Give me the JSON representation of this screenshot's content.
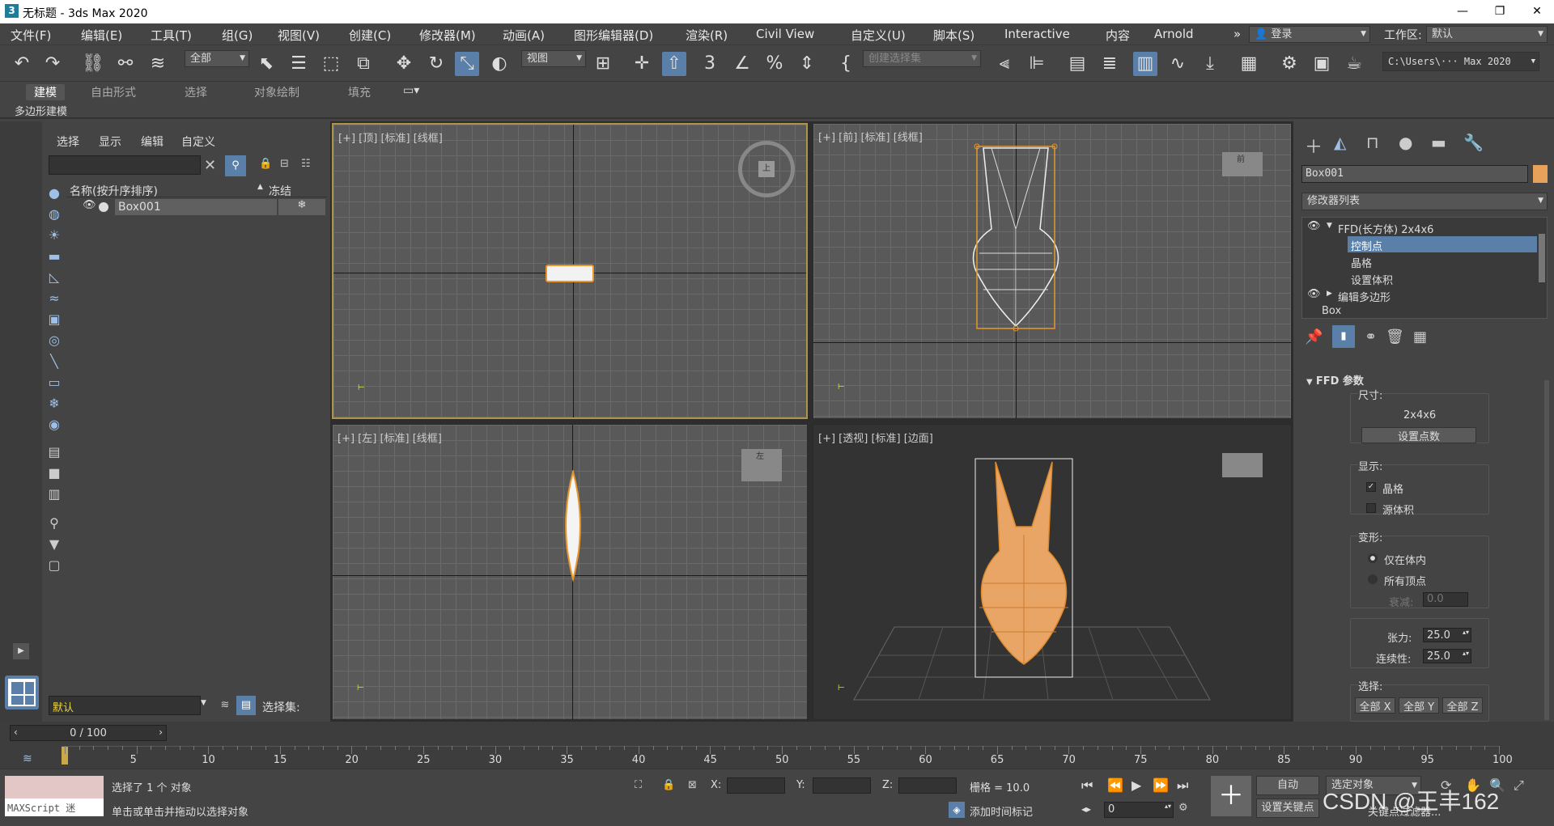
{
  "window": {
    "title": "无标题 - 3ds Max 2020",
    "app_icon": "3",
    "min": "—",
    "max": "❐",
    "close": "✕"
  },
  "menu": [
    "文件(F)",
    "编辑(E)",
    "工具(T)",
    "组(G)",
    "视图(V)",
    "创建(C)",
    "修改器(M)",
    "动画(A)",
    "图形编辑器(D)",
    "渲染(R)",
    "Civil View",
    "自定义(U)",
    "脚本(S)",
    "Interactive",
    "内容",
    "Arnold"
  ],
  "menu_more": "»",
  "login": "登录",
  "workspace_label": "工作区:",
  "workspace_value": "默认",
  "toolbar": {
    "filter": "全部",
    "ref_coord": "视图",
    "create_sel_set": "创建选择集",
    "path": "C:\\Users\\··· Max 2020",
    "spinner_label": "3"
  },
  "ribbon_tabs": [
    "建模",
    "自由形式",
    "选择",
    "对象绘制",
    "填充"
  ],
  "ribbon_sub": "多边形建模",
  "explorer": {
    "menu": [
      "选择",
      "显示",
      "编辑",
      "自定义"
    ],
    "col_name": "名称(按升序排序)",
    "col_freeze": "冻结",
    "row": "Box001",
    "layer": "默认",
    "selset": "选择集:"
  },
  "viewports": [
    {
      "id": "top",
      "label": "[+] [顶] [标准] [线框]"
    },
    {
      "id": "front",
      "label": "[+] [前] [标准] [线框]"
    },
    {
      "id": "left",
      "label": "[+] [左] [标准] [线框]"
    },
    {
      "id": "persp",
      "label": "[+] [透视] [标准] [边面]"
    }
  ],
  "viewcube": {
    "top": "上",
    "front": "前",
    "left": "左"
  },
  "cmd": {
    "object_name": "Box001",
    "modifier_list": "修改器列表",
    "stack": [
      {
        "label": "FFD(长方体) 2x4x6",
        "level": 0
      },
      {
        "label": "控制点",
        "level": 1,
        "selected": true
      },
      {
        "label": "晶格",
        "level": 1
      },
      {
        "label": "设置体积",
        "level": 1
      },
      {
        "label": "编辑多边形",
        "level": 0
      },
      {
        "label": "Box",
        "level": 0
      }
    ],
    "rollout_title": "FFD 参数",
    "dim_label": "尺寸:",
    "dim_value": "2x4x6",
    "set_points": "设置点数",
    "display_label": "显示:",
    "lattice": "晶格",
    "source_volume": "源体积",
    "deform_label": "变形:",
    "only_in_volume": "仅在体内",
    "all_vertices": "所有顶点",
    "falloff_label": "衰减:",
    "falloff_value": "0.0",
    "tension_label": "张力:",
    "tension_value": "25.0",
    "continuity_label": "连续性:",
    "continuity_value": "25.0",
    "select_label": "选择:",
    "sel_x": "全部 X",
    "sel_y": "全部 Y",
    "sel_z": "全部 Z"
  },
  "timeline": {
    "frame": "0 / 100",
    "ticks": [
      "5",
      "10",
      "15",
      "20",
      "25",
      "30",
      "35",
      "40",
      "45",
      "50",
      "55",
      "60",
      "65",
      "70",
      "75",
      "80",
      "85",
      "90",
      "95",
      "100"
    ]
  },
  "status": {
    "maxscript": "MAXScript 迷",
    "selected": "选择了 1 个 对象",
    "hint": "单击或单击并拖动以选择对象",
    "x": "X:",
    "y": "Y:",
    "z": "Z:",
    "grid": "栅格 = 10.0",
    "add_tag": "添加时间标记",
    "auto": "自动",
    "sel_obj": "选定对象",
    "set_key": "设置关键点",
    "key_filter": "关键点过滤器...",
    "frame_spin": "0",
    "watermark": "CSDN @王丰162"
  },
  "colors": {
    "accent_orange": "#e8962c",
    "selection_blue": "#5a7fa8",
    "active_border": "#b09348",
    "swatch": "#e8a15a"
  }
}
